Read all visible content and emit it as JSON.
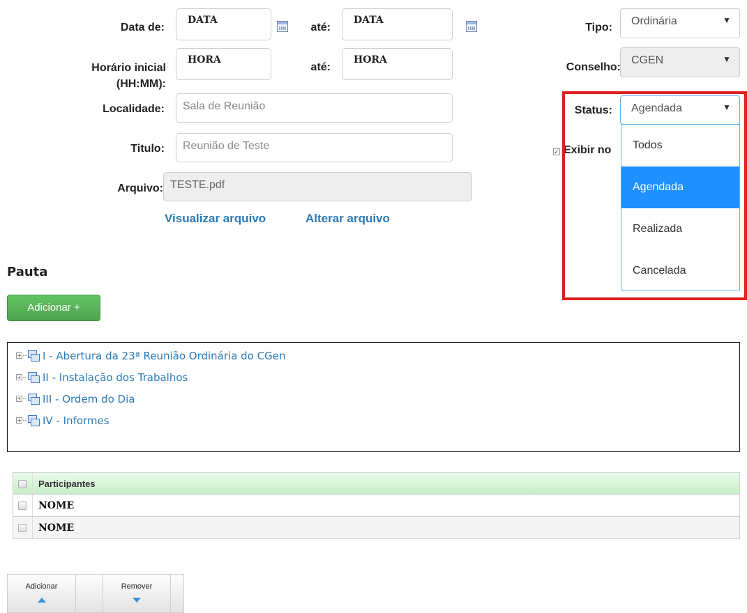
{
  "form": {
    "data_de_label": "Data de:",
    "data_de_value": "DATA",
    "data_ate_label": "até:",
    "data_ate_value": "DATA",
    "hora_label_line1": "Horário inicial",
    "hora_label_line2": "(HH:MM):",
    "hora_de_value": "HORA",
    "hora_ate_label": "até:",
    "hora_ate_value": "HORA",
    "localidade_label": "Localidade:",
    "localidade_placeholder": "Sala de Reunião",
    "titulo_label": "Titulo:",
    "titulo_placeholder": "Reunião de Teste",
    "arquivo_label": "Arquivo:",
    "arquivo_value": "TESTE.pdf",
    "visualizar_link": "Visualizar arquivo",
    "alterar_link": "Alterar arquivo"
  },
  "right": {
    "tipo_label": "Tipo:",
    "tipo_value": "Ordinária",
    "conselho_label": "Conselho:",
    "conselho_value": "CGEN",
    "status_label": "Status:",
    "status_value": "Agendada",
    "exibir_label": "Exibir no",
    "status_options": [
      "Todos",
      "Agendada",
      "Realizada",
      "Cancelada"
    ],
    "highlight_color": "#e0201e"
  },
  "pauta": {
    "title": "Pauta",
    "add_button": "Adicionar +",
    "items": [
      "I - Abertura da 23ª Reunião Ordinária do CGen",
      "II - Instalação dos Trabalhos",
      "III - Ordem do Dia",
      "IV - Informes"
    ]
  },
  "participantes": {
    "header": "Participantes",
    "rows": [
      "NOME",
      "NOME"
    ]
  },
  "toolbar": {
    "adicionar": "Adicionar",
    "remover": "Remover"
  }
}
